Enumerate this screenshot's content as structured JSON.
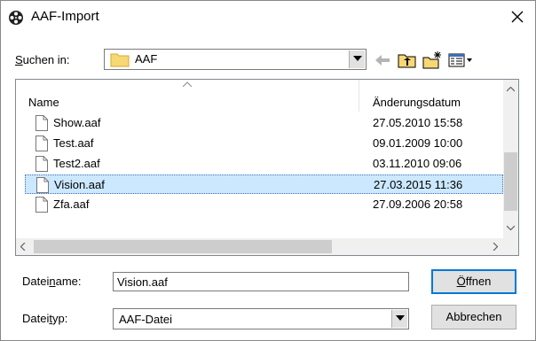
{
  "window": {
    "title": "AAF-Import",
    "app_icon": "movie-reel-icon",
    "close_icon": "close-icon"
  },
  "lookin": {
    "label_pre": "",
    "label_u": "S",
    "label_post": "uchen in:",
    "value": "AAF",
    "folder_icon": "folder-icon"
  },
  "toolbar": {
    "icons": [
      "back-arrow-icon",
      "up-folder-icon",
      "new-folder-icon",
      "view-menu-icon"
    ]
  },
  "filelist": {
    "columns": {
      "name": "Name",
      "date": "Änderungsdatum"
    },
    "files": [
      {
        "name": "Show.aaf",
        "date": "27.05.2010 15:58",
        "selected": false
      },
      {
        "name": "Test.aaf",
        "date": "09.01.2009 10:00",
        "selected": false
      },
      {
        "name": "Test2.aaf",
        "date": "03.11.2010 09:06",
        "selected": false
      },
      {
        "name": "Vision.aaf",
        "date": "27.03.2015 11:36",
        "selected": true
      },
      {
        "name": "Zfa.aaf",
        "date": "27.09.2006 20:58",
        "selected": false
      }
    ],
    "scroll_up": "▲",
    "scroll_down": "▼",
    "scroll_left": "<",
    "scroll_right": ">"
  },
  "filename": {
    "label_pre": "Datei",
    "label_u": "n",
    "label_post": "ame:",
    "value": "Vision.aaf"
  },
  "filetype": {
    "label_pre": "Datei",
    "label_u": "t",
    "label_post": "yp:",
    "value": "AAF-Datei"
  },
  "buttons": {
    "open_pre": "",
    "open_u": "Ö",
    "open_post": "ffnen",
    "cancel": "Abbrechen"
  },
  "colors": {
    "selection": "#cce8ff",
    "accent": "#0078d7"
  }
}
